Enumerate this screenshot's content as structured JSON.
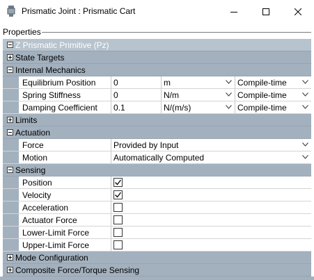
{
  "window": {
    "title": "Prismatic Joint : Prismatic Cart",
    "controls": {
      "minimize": "minimize-icon",
      "maximize": "maximize-icon",
      "close": "close-icon"
    }
  },
  "properties_label": "Properties",
  "colors": {
    "section": "#a3b1be",
    "top_section": "#b7c3cd",
    "grid_line": "#d4d4d4"
  },
  "sections": {
    "primitive": {
      "label": "Z Prismatic Primitive (Pz)",
      "state": "expanded"
    },
    "state_targets": {
      "label": "State Targets",
      "state": "collapsed"
    },
    "internal_mechanics": {
      "label": "Internal Mechanics",
      "state": "expanded",
      "rows": [
        {
          "name": "Equilibrium Position",
          "value": "0",
          "unit": "m",
          "mode": "Compile-time"
        },
        {
          "name": "Spring Stiffness",
          "value": "0",
          "unit": "N/m",
          "mode": "Compile-time"
        },
        {
          "name": "Damping Coefficient",
          "value": "0.1",
          "unit": "N/(m/s)",
          "mode": "Compile-time"
        }
      ]
    },
    "limits": {
      "label": "Limits",
      "state": "collapsed"
    },
    "actuation": {
      "label": "Actuation",
      "state": "expanded",
      "rows": [
        {
          "name": "Force",
          "value": "Provided by Input"
        },
        {
          "name": "Motion",
          "value": "Automatically Computed"
        }
      ]
    },
    "sensing": {
      "label": "Sensing",
      "state": "expanded",
      "rows": [
        {
          "name": "Position",
          "checked": true
        },
        {
          "name": "Velocity",
          "checked": true
        },
        {
          "name": "Acceleration",
          "checked": false
        },
        {
          "name": "Actuator Force",
          "checked": false
        },
        {
          "name": "Lower-Limit Force",
          "checked": false
        },
        {
          "name": "Upper-Limit Force",
          "checked": false
        }
      ]
    },
    "mode_configuration": {
      "label": "Mode Configuration",
      "state": "collapsed"
    },
    "composite_sensing": {
      "label": "Composite Force/Torque Sensing",
      "state": "collapsed"
    }
  }
}
